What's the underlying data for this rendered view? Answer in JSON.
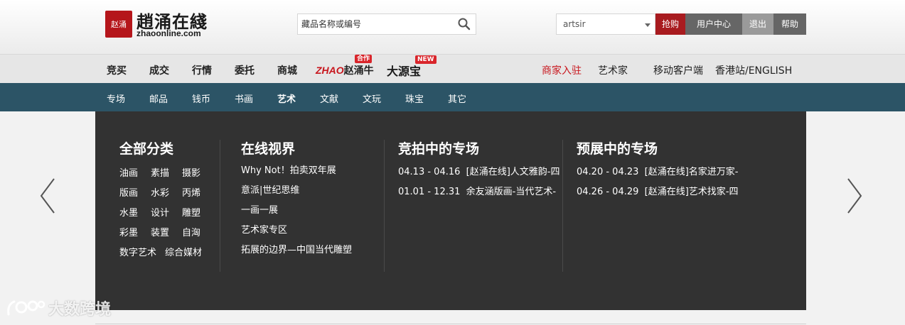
{
  "header": {
    "logo": {
      "seal_text": "赵涌",
      "name": "趙涌在綫",
      "domain": "zhaoonline.com"
    },
    "search": {
      "placeholder": "藏品名称或编号",
      "icon": "search-icon"
    },
    "user_select": {
      "value": "artsir"
    },
    "buttons": {
      "buy": "抢购",
      "user_center": "用户中心",
      "logout": "退出",
      "help": "帮助"
    },
    "colors": {
      "buy": "#a81b1f",
      "dark_button": "#666666",
      "logout": "#9a9a9a"
    }
  },
  "main_nav": {
    "items": [
      "竞买",
      "成交",
      "行情",
      "委托",
      "商城"
    ],
    "brand_zhao": {
      "prefix": "ZHAO",
      "name": "赵涌牛",
      "badge": "合作"
    },
    "brand_dys": {
      "name": "大源宝",
      "badge": "NEW"
    },
    "right": {
      "merchant": "商家入驻",
      "artist": "艺术家",
      "mobile": "移动客户端",
      "hk": "香港站/ENGLISH"
    }
  },
  "sub_nav": {
    "items": [
      "专场",
      "邮品",
      "钱币",
      "书画",
      "艺术",
      "文献",
      "文玩",
      "珠宝",
      "其它"
    ],
    "active": "艺术",
    "background": "#2c5466"
  },
  "panel": {
    "all_categories": {
      "title": "全部分类",
      "rows": [
        [
          "油画",
          "素描",
          "摄影"
        ],
        [
          "版画",
          "水彩",
          "丙烯"
        ],
        [
          "水墨",
          "设计",
          "雕塑"
        ],
        [
          "彩墨",
          "装置",
          "自洶"
        ],
        [
          "数字艺术",
          "综合媒材"
        ]
      ]
    },
    "online_vision": {
      "title": "在线视界",
      "links": [
        "Why Not！拍卖双年展",
        "意派|世纪思维",
        "一画一展",
        "艺术家专区",
        "拓展的边界—中国当代雕塑"
      ]
    },
    "live_auctions": {
      "title": "竞拍中的专场",
      "items": [
        {
          "dates": "04.13 - 04.16",
          "name": "[赵涌在线]人文雅韵-四"
        },
        {
          "dates": "01.01 - 12.31",
          "name": "余友涵版画-当代艺术-"
        }
      ]
    },
    "preview_auctions": {
      "title": "预展中的专场",
      "items": [
        {
          "dates": "04.20 - 04.23",
          "name": "[赵涌在线]名家进万家-"
        },
        {
          "dates": "04.26 - 04.29",
          "name": "[赵涌在线]艺术找家-四"
        }
      ]
    },
    "background": "#323232"
  },
  "watermark": {
    "text": "大数跨境"
  }
}
